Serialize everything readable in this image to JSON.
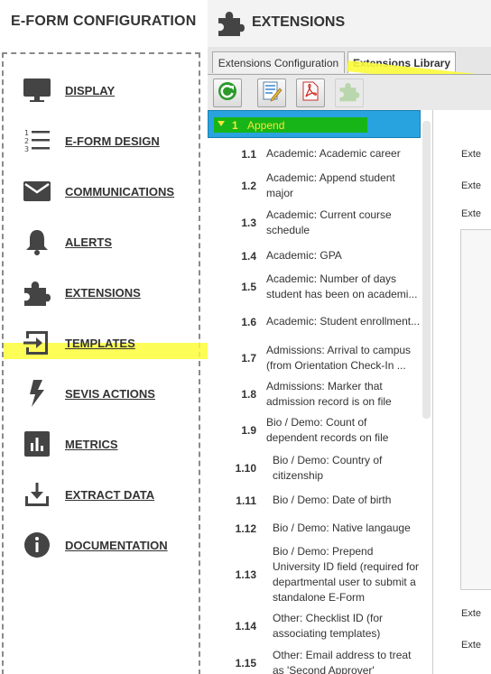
{
  "left": {
    "title": "E-FORM CONFIGURATION",
    "nav": [
      {
        "label": "DISPLAY",
        "icon": "monitor-icon"
      },
      {
        "label": "E-FORM DESIGN",
        "icon": "numbered-list-icon"
      },
      {
        "label": "COMMUNICATIONS",
        "icon": "envelope-icon"
      },
      {
        "label": "ALERTS",
        "icon": "bell-icon"
      },
      {
        "label": "EXTENSIONS",
        "icon": "puzzle-icon"
      },
      {
        "label": "TEMPLATES",
        "icon": "import-arrow-icon"
      },
      {
        "label": "SEVIS ACTIONS",
        "icon": "lightning-icon"
      },
      {
        "label": "METRICS",
        "icon": "bar-chart-icon"
      },
      {
        "label": "EXTRACT DATA",
        "icon": "download-icon"
      },
      {
        "label": "DOCUMENTATION",
        "icon": "info-icon"
      }
    ]
  },
  "header": {
    "title": "EXTENSIONS",
    "icon": "puzzle-icon"
  },
  "tabs": [
    {
      "label": "Extensions Configuration",
      "active": false
    },
    {
      "label": "Extensions Library",
      "active": true
    }
  ],
  "toolbar": [
    {
      "icon": "refresh-icon"
    },
    {
      "icon": "edit-document-icon"
    },
    {
      "icon": "pdf-icon"
    },
    {
      "icon": "puzzle-disabled-icon"
    }
  ],
  "tree": {
    "root": {
      "num": "1",
      "label": "Append"
    },
    "items": [
      {
        "num": "1.1",
        "label": "Academic: Academic career"
      },
      {
        "num": "1.2",
        "label": "Academic: Append student major"
      },
      {
        "num": "1.3",
        "label": "Academic: Current course schedule"
      },
      {
        "num": "1.4",
        "label": "Academic: GPA"
      },
      {
        "num": "1.5",
        "label": "Academic: Number of days student has been on academi..."
      },
      {
        "num": "1.6",
        "label": "Academic: Student enrollment..."
      },
      {
        "num": "1.7",
        "label": "Admissions: Arrival to campus (from Orientation Check-In ..."
      },
      {
        "num": "1.8",
        "label": "Admissions: Marker that admission record is on file"
      },
      {
        "num": "1.9",
        "label": "Bio / Demo: Count of dependent records on file"
      },
      {
        "num": "1.10",
        "label": "Bio / Demo: Country of citizenship"
      },
      {
        "num": "1.11",
        "label": "Bio / Demo: Date of birth"
      },
      {
        "num": "1.12",
        "label": "Bio / Demo: Native langauge"
      },
      {
        "num": "1.13",
        "label": "Bio / Demo: Prepend University ID field (required for departmental user to submit a standalone E-Form"
      },
      {
        "num": "1.14",
        "label": "Other: Checklist ID (for associating templates)"
      },
      {
        "num": "1.15",
        "label": "Other: Email address to treat as 'Second Approver'"
      }
    ]
  },
  "right_panel": {
    "labels": [
      "Exte",
      "Exte",
      "Exte",
      "Exte",
      "Exte"
    ]
  },
  "colors": {
    "highlight": "#fdfd3a",
    "selection": "#29a3df",
    "selection_bar": "#17b517",
    "selection_text": "#f5e73a"
  }
}
